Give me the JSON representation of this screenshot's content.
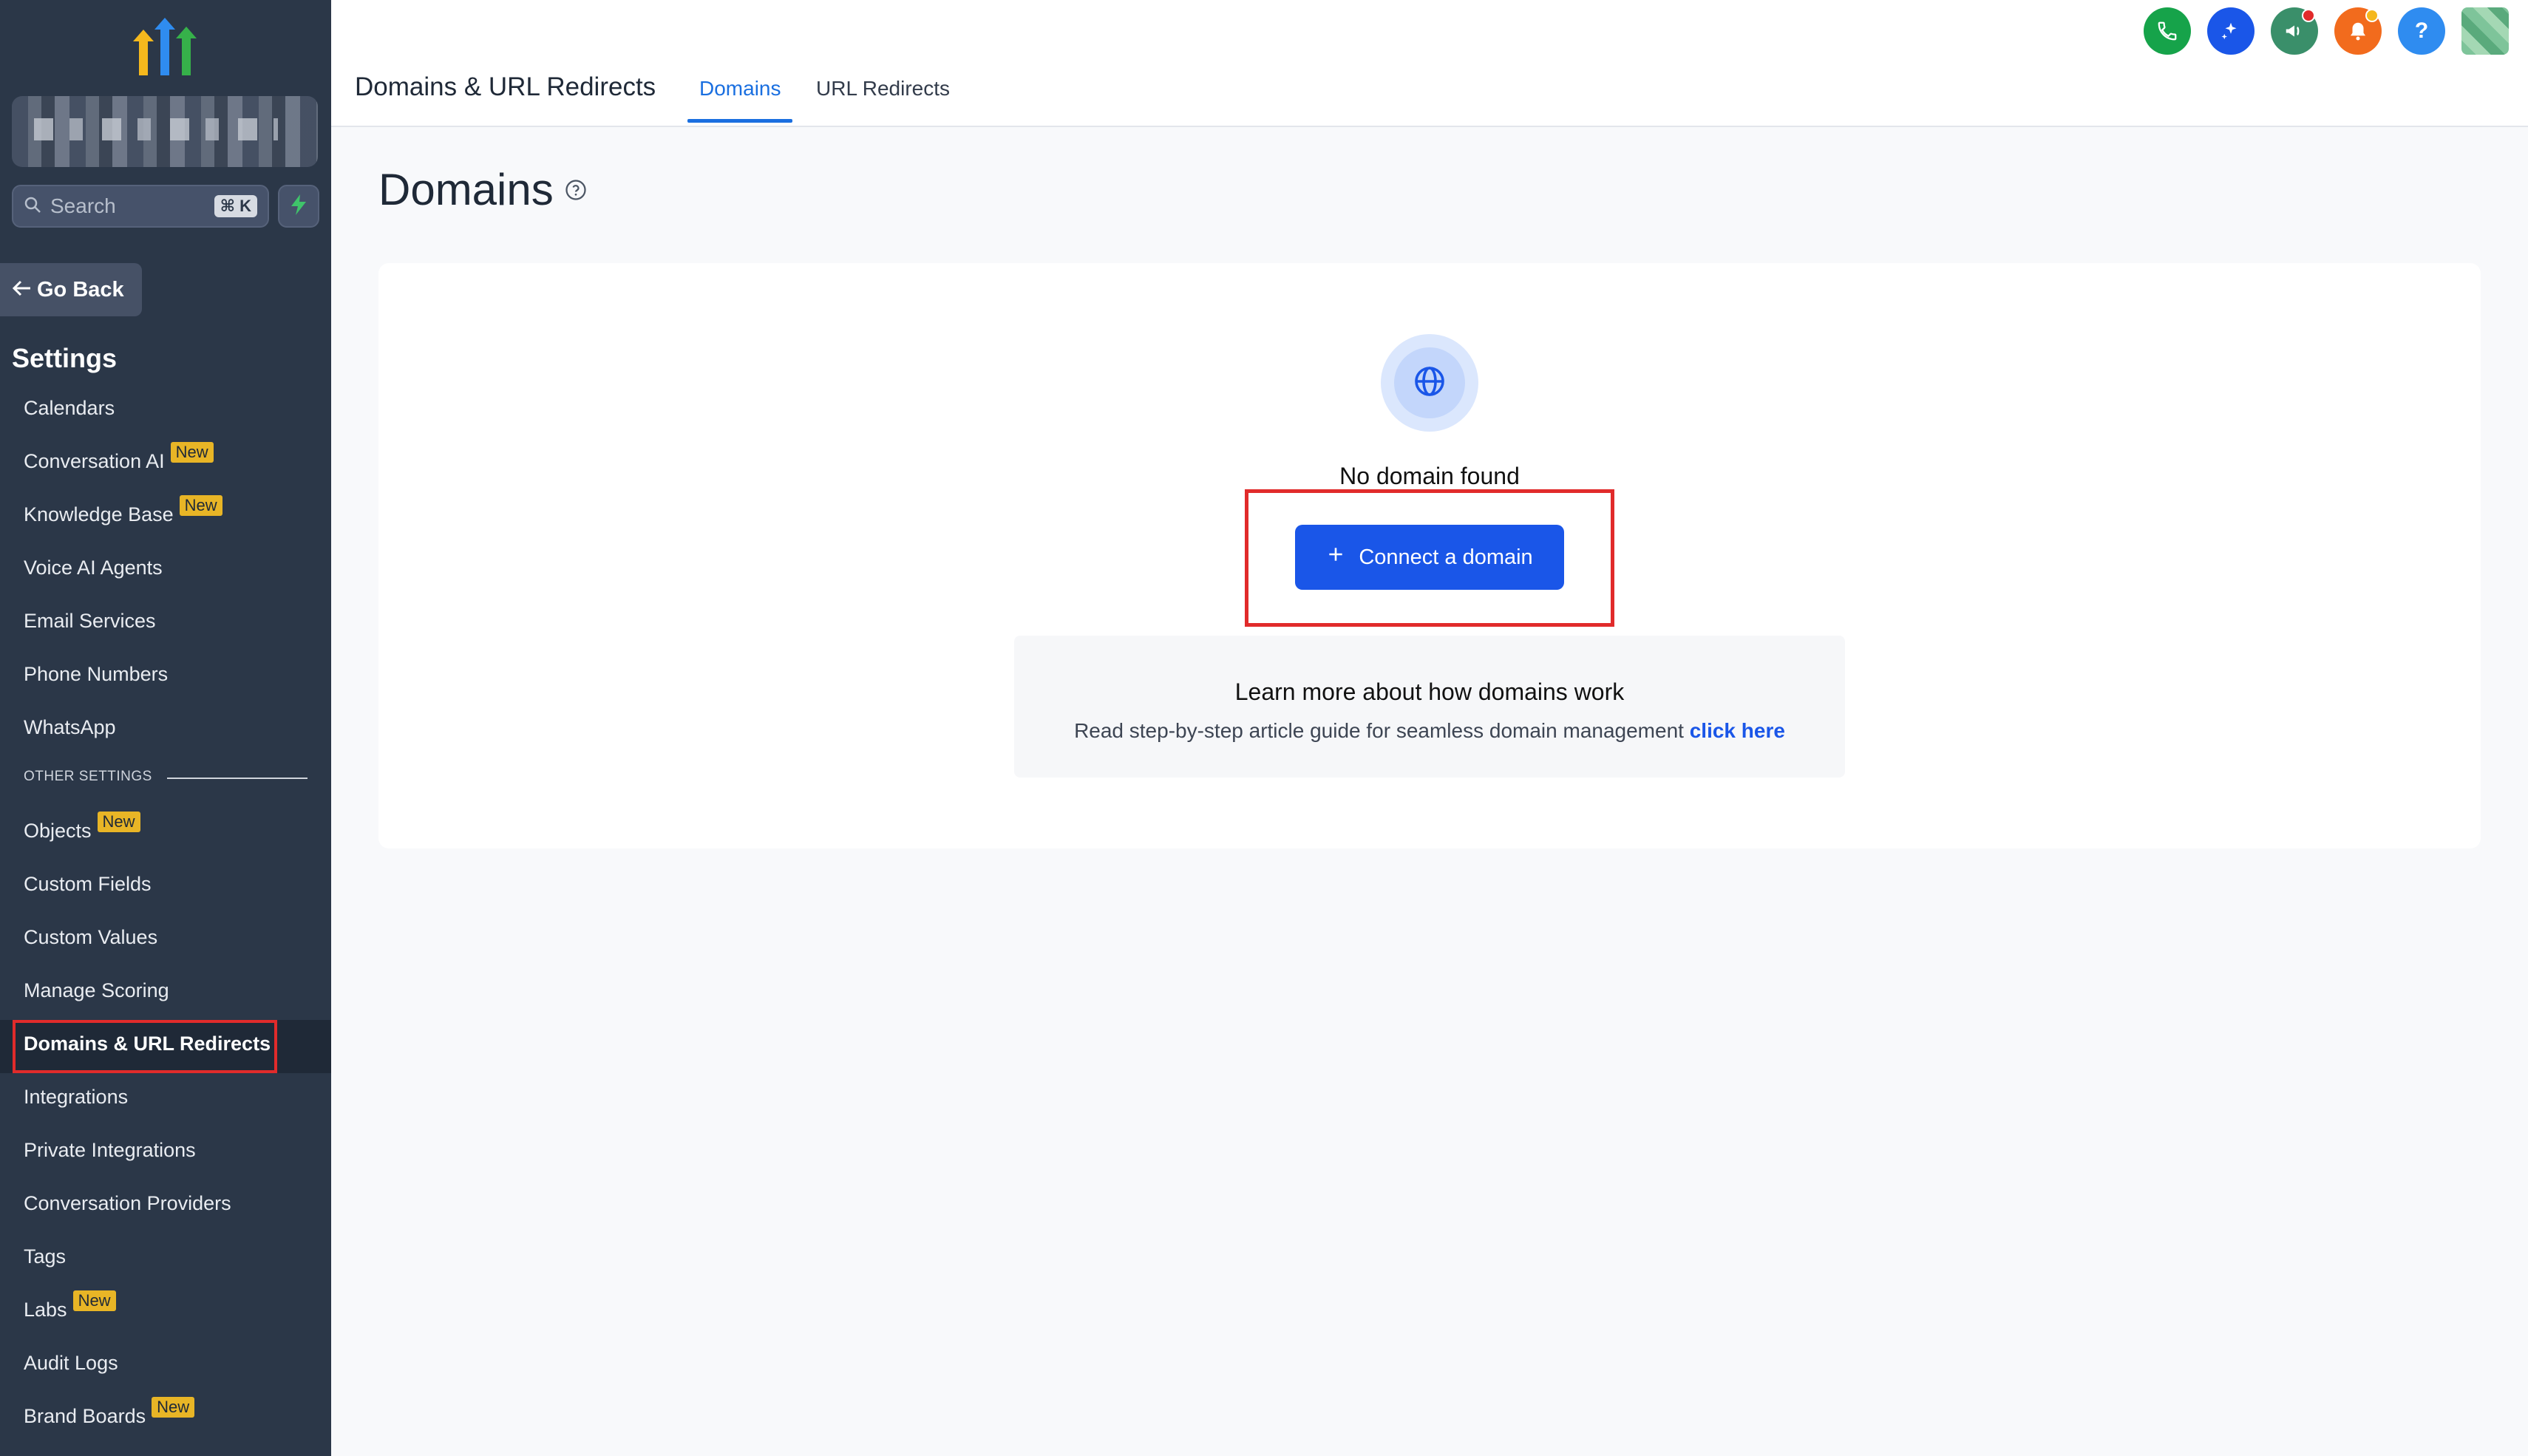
{
  "sidebar": {
    "search": {
      "label": "Search",
      "shortcut": "⌘ K"
    },
    "go_back": "Go Back",
    "heading": "Settings",
    "items": [
      {
        "label": "Calendars",
        "badge": ""
      },
      {
        "label": "Conversation AI",
        "badge": "New"
      },
      {
        "label": "Knowledge Base",
        "badge": "New"
      },
      {
        "label": "Voice AI Agents",
        "badge": ""
      },
      {
        "label": "Email Services",
        "badge": ""
      },
      {
        "label": "Phone Numbers",
        "badge": ""
      },
      {
        "label": "WhatsApp",
        "badge": ""
      }
    ],
    "other_settings_label": "OTHER SETTINGS",
    "other_items": [
      {
        "label": "Objects",
        "badge": "New"
      },
      {
        "label": "Custom Fields",
        "badge": ""
      },
      {
        "label": "Custom Values",
        "badge": ""
      },
      {
        "label": "Manage Scoring",
        "badge": ""
      },
      {
        "label": "Domains & URL Redirects",
        "badge": "",
        "active": true
      },
      {
        "label": "Integrations",
        "badge": ""
      },
      {
        "label": "Private Integrations",
        "badge": ""
      },
      {
        "label": "Conversation Providers",
        "badge": ""
      },
      {
        "label": "Tags",
        "badge": ""
      },
      {
        "label": "Labs",
        "badge": "New"
      },
      {
        "label": "Audit Logs",
        "badge": ""
      },
      {
        "label": "Brand Boards",
        "badge": "New"
      }
    ]
  },
  "header": {
    "title": "Domains & URL Redirects",
    "tabs": [
      {
        "label": "Domains",
        "active": true
      },
      {
        "label": "URL Redirects",
        "active": false
      }
    ]
  },
  "top_icons": [
    {
      "name": "phone-icon",
      "color": "#16a34a"
    },
    {
      "name": "sparkle-icon",
      "color": "#1a56e8"
    },
    {
      "name": "megaphone-icon",
      "color": "#3a8f6a"
    },
    {
      "name": "bell-icon",
      "color": "#f26b1d"
    },
    {
      "name": "help-icon",
      "color": "#2f8cf0"
    }
  ],
  "main": {
    "page_title": "Domains",
    "empty_state": "No domain found",
    "connect_button": "Connect a domain",
    "learn_title": "Learn more about how domains work",
    "learn_sub": "Read step-by-step article guide for seamless domain management",
    "learn_link": "click here"
  },
  "colors": {
    "sidebar_bg": "#2b3748",
    "primary": "#1a56e8",
    "highlight": "#e12b2b",
    "badge": "#e8b526"
  }
}
